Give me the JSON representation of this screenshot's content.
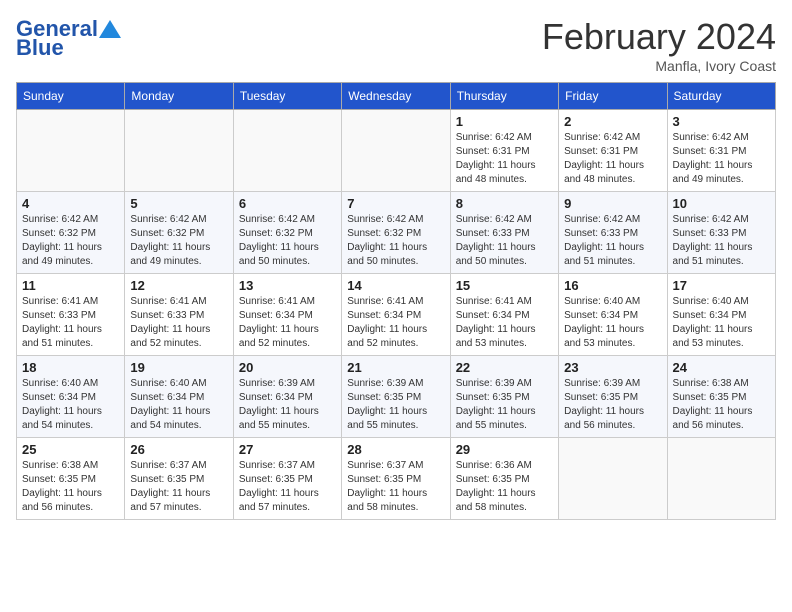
{
  "header": {
    "logo_line1": "General",
    "logo_line2": "Blue",
    "month_title": "February 2024",
    "location": "Manfla, Ivory Coast"
  },
  "days_of_week": [
    "Sunday",
    "Monday",
    "Tuesday",
    "Wednesday",
    "Thursday",
    "Friday",
    "Saturday"
  ],
  "weeks": [
    [
      {
        "day": "",
        "info": ""
      },
      {
        "day": "",
        "info": ""
      },
      {
        "day": "",
        "info": ""
      },
      {
        "day": "",
        "info": ""
      },
      {
        "day": "1",
        "info": "Sunrise: 6:42 AM\nSunset: 6:31 PM\nDaylight: 11 hours\nand 48 minutes."
      },
      {
        "day": "2",
        "info": "Sunrise: 6:42 AM\nSunset: 6:31 PM\nDaylight: 11 hours\nand 48 minutes."
      },
      {
        "day": "3",
        "info": "Sunrise: 6:42 AM\nSunset: 6:31 PM\nDaylight: 11 hours\nand 49 minutes."
      }
    ],
    [
      {
        "day": "4",
        "info": "Sunrise: 6:42 AM\nSunset: 6:32 PM\nDaylight: 11 hours\nand 49 minutes."
      },
      {
        "day": "5",
        "info": "Sunrise: 6:42 AM\nSunset: 6:32 PM\nDaylight: 11 hours\nand 49 minutes."
      },
      {
        "day": "6",
        "info": "Sunrise: 6:42 AM\nSunset: 6:32 PM\nDaylight: 11 hours\nand 50 minutes."
      },
      {
        "day": "7",
        "info": "Sunrise: 6:42 AM\nSunset: 6:32 PM\nDaylight: 11 hours\nand 50 minutes."
      },
      {
        "day": "8",
        "info": "Sunrise: 6:42 AM\nSunset: 6:33 PM\nDaylight: 11 hours\nand 50 minutes."
      },
      {
        "day": "9",
        "info": "Sunrise: 6:42 AM\nSunset: 6:33 PM\nDaylight: 11 hours\nand 51 minutes."
      },
      {
        "day": "10",
        "info": "Sunrise: 6:42 AM\nSunset: 6:33 PM\nDaylight: 11 hours\nand 51 minutes."
      }
    ],
    [
      {
        "day": "11",
        "info": "Sunrise: 6:41 AM\nSunset: 6:33 PM\nDaylight: 11 hours\nand 51 minutes."
      },
      {
        "day": "12",
        "info": "Sunrise: 6:41 AM\nSunset: 6:33 PM\nDaylight: 11 hours\nand 52 minutes."
      },
      {
        "day": "13",
        "info": "Sunrise: 6:41 AM\nSunset: 6:34 PM\nDaylight: 11 hours\nand 52 minutes."
      },
      {
        "day": "14",
        "info": "Sunrise: 6:41 AM\nSunset: 6:34 PM\nDaylight: 11 hours\nand 52 minutes."
      },
      {
        "day": "15",
        "info": "Sunrise: 6:41 AM\nSunset: 6:34 PM\nDaylight: 11 hours\nand 53 minutes."
      },
      {
        "day": "16",
        "info": "Sunrise: 6:40 AM\nSunset: 6:34 PM\nDaylight: 11 hours\nand 53 minutes."
      },
      {
        "day": "17",
        "info": "Sunrise: 6:40 AM\nSunset: 6:34 PM\nDaylight: 11 hours\nand 53 minutes."
      }
    ],
    [
      {
        "day": "18",
        "info": "Sunrise: 6:40 AM\nSunset: 6:34 PM\nDaylight: 11 hours\nand 54 minutes."
      },
      {
        "day": "19",
        "info": "Sunrise: 6:40 AM\nSunset: 6:34 PM\nDaylight: 11 hours\nand 54 minutes."
      },
      {
        "day": "20",
        "info": "Sunrise: 6:39 AM\nSunset: 6:34 PM\nDaylight: 11 hours\nand 55 minutes."
      },
      {
        "day": "21",
        "info": "Sunrise: 6:39 AM\nSunset: 6:35 PM\nDaylight: 11 hours\nand 55 minutes."
      },
      {
        "day": "22",
        "info": "Sunrise: 6:39 AM\nSunset: 6:35 PM\nDaylight: 11 hours\nand 55 minutes."
      },
      {
        "day": "23",
        "info": "Sunrise: 6:39 AM\nSunset: 6:35 PM\nDaylight: 11 hours\nand 56 minutes."
      },
      {
        "day": "24",
        "info": "Sunrise: 6:38 AM\nSunset: 6:35 PM\nDaylight: 11 hours\nand 56 minutes."
      }
    ],
    [
      {
        "day": "25",
        "info": "Sunrise: 6:38 AM\nSunset: 6:35 PM\nDaylight: 11 hours\nand 56 minutes."
      },
      {
        "day": "26",
        "info": "Sunrise: 6:37 AM\nSunset: 6:35 PM\nDaylight: 11 hours\nand 57 minutes."
      },
      {
        "day": "27",
        "info": "Sunrise: 6:37 AM\nSunset: 6:35 PM\nDaylight: 11 hours\nand 57 minutes."
      },
      {
        "day": "28",
        "info": "Sunrise: 6:37 AM\nSunset: 6:35 PM\nDaylight: 11 hours\nand 58 minutes."
      },
      {
        "day": "29",
        "info": "Sunrise: 6:36 AM\nSunset: 6:35 PM\nDaylight: 11 hours\nand 58 minutes."
      },
      {
        "day": "",
        "info": ""
      },
      {
        "day": "",
        "info": ""
      }
    ]
  ]
}
